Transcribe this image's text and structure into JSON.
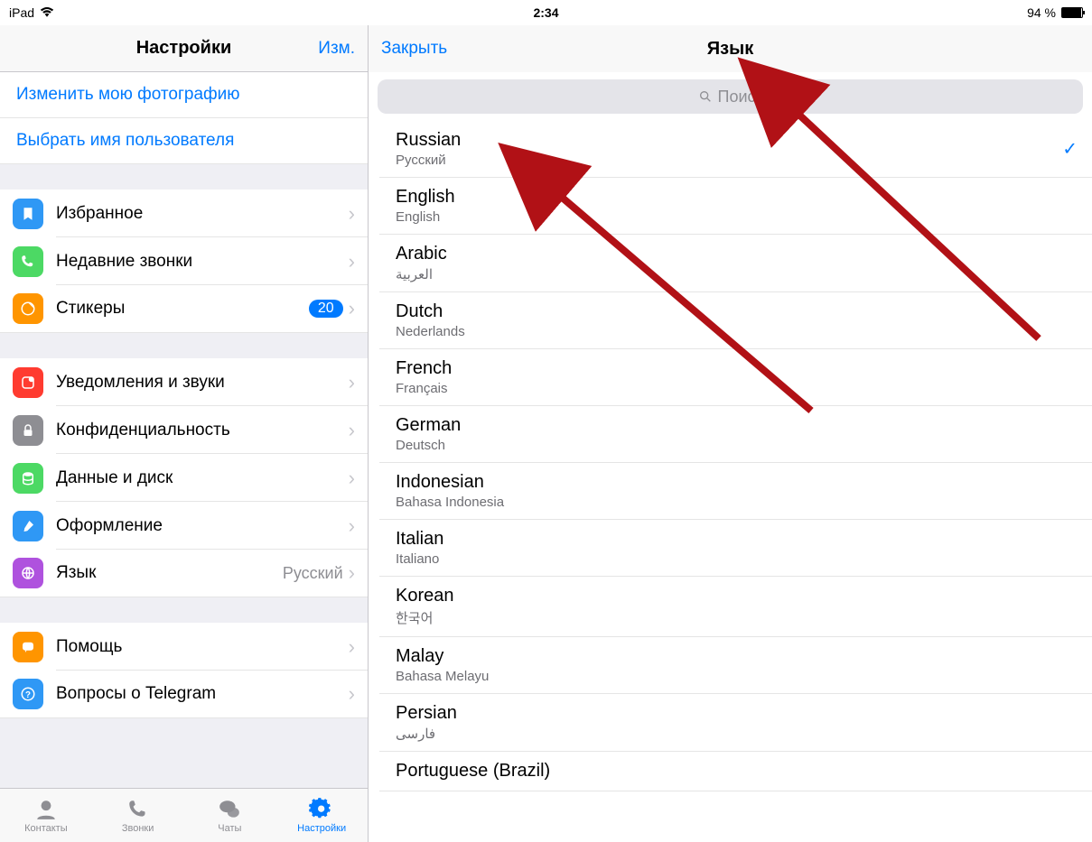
{
  "statusbar": {
    "device": "iPad",
    "time": "2:34",
    "battery_text": "94 %"
  },
  "left": {
    "title": "Настройки",
    "edit": "Изм.",
    "links": {
      "change_photo": "Изменить мою фотографию",
      "choose_username": "Выбрать имя пользователя"
    },
    "rows": {
      "favorites": "Избранное",
      "recent_calls": "Недавние звонки",
      "stickers": "Стикеры",
      "stickers_badge": "20",
      "notifications": "Уведомления и звуки",
      "privacy": "Конфиденциальность",
      "data": "Данные и диск",
      "appearance": "Оформление",
      "language": "Язык",
      "language_value": "Русский",
      "help": "Помощь",
      "faq": "Вопросы о Telegram"
    },
    "tabs": {
      "contacts": "Контакты",
      "calls": "Звонки",
      "chats": "Чаты",
      "settings": "Настройки"
    }
  },
  "right": {
    "close": "Закрыть",
    "title": "Язык",
    "search_placeholder": "Поиск",
    "languages": [
      {
        "primary": "Russian",
        "secondary": "Русский",
        "selected": true
      },
      {
        "primary": "English",
        "secondary": "English"
      },
      {
        "primary": "Arabic",
        "secondary": "العربية"
      },
      {
        "primary": "Dutch",
        "secondary": "Nederlands"
      },
      {
        "primary": "French",
        "secondary": "Français"
      },
      {
        "primary": "German",
        "secondary": "Deutsch"
      },
      {
        "primary": "Indonesian",
        "secondary": "Bahasa Indonesia"
      },
      {
        "primary": "Italian",
        "secondary": "Italiano"
      },
      {
        "primary": "Korean",
        "secondary": "한국어"
      },
      {
        "primary": "Malay",
        "secondary": "Bahasa Melayu"
      },
      {
        "primary": "Persian",
        "secondary": "فارسی"
      },
      {
        "primary": "Portuguese (Brazil)",
        "secondary": ""
      }
    ]
  },
  "icon_colors": {
    "favorites": "#2f98f5",
    "calls": "#4cd964",
    "stickers": "#ff9500",
    "notifications": "#ff3b30",
    "privacy": "#8e8e93",
    "data": "#4cd964",
    "appearance": "#2f98f5",
    "language": "#af52de",
    "help": "#ff9500",
    "faq": "#2f98f5"
  }
}
